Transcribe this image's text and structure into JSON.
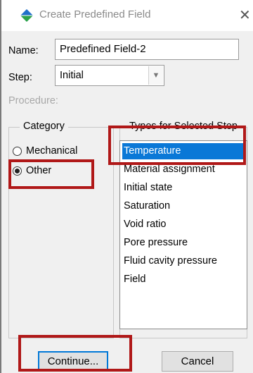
{
  "dialog": {
    "title": "Create Predefined Field",
    "close_symbol": "✕"
  },
  "form": {
    "name_label": "Name:",
    "name_value": "Predefined Field-2",
    "step_label": "Step:",
    "step_value": "Initial",
    "procedure_label": "Procedure:"
  },
  "category": {
    "title": "Category",
    "options": [
      {
        "label": "Mechanical",
        "checked": false
      },
      {
        "label": "Other",
        "checked": true
      }
    ]
  },
  "types": {
    "title": "Types for Selected Step",
    "items": [
      {
        "label": "Temperature",
        "selected": true
      },
      {
        "label": "Material assignment",
        "selected": false
      },
      {
        "label": "Initial state",
        "selected": false
      },
      {
        "label": "Saturation",
        "selected": false
      },
      {
        "label": "Void ratio",
        "selected": false
      },
      {
        "label": "Pore pressure",
        "selected": false
      },
      {
        "label": "Fluid cavity pressure",
        "selected": false
      },
      {
        "label": "Field",
        "selected": false
      }
    ]
  },
  "buttons": {
    "continue_label": "Continue...",
    "cancel_label": "Cancel"
  },
  "colors": {
    "selection": "#0a78d7",
    "highlight": "#b01818"
  }
}
